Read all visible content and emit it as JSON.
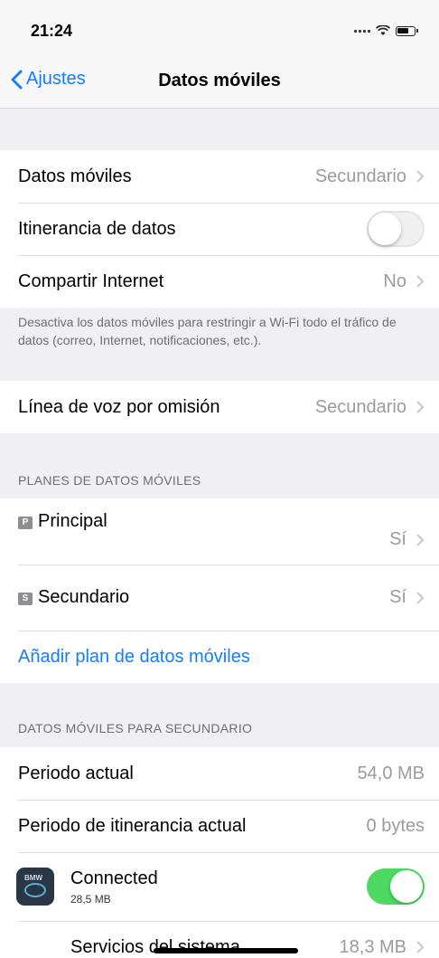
{
  "status": {
    "time": "21:24"
  },
  "nav": {
    "back_label": "Ajustes",
    "title": "Datos móviles"
  },
  "group1": {
    "datos_moviles": {
      "label": "Datos móviles",
      "value": "Secundario"
    },
    "itinerancia": {
      "label": "Itinerancia de datos",
      "enabled": false
    },
    "compartir": {
      "label": "Compartir Internet",
      "value": "No"
    }
  },
  "footnote": "Desactiva los datos móviles para restringir a Wi-Fi todo el tráfico de datos (correo, Internet, notificaciones, etc.).",
  "voice": {
    "label": "Línea de voz por omisión",
    "value": "Secundario"
  },
  "plans": {
    "header": "PLANES DE DATOS MÓVILES",
    "items": [
      {
        "badge": "P",
        "label": "Principal",
        "value": "Sí"
      },
      {
        "badge": "S",
        "label": "Secundario",
        "value": "Sí"
      }
    ],
    "add_label": "Añadir plan de datos móviles"
  },
  "usage": {
    "header": "DATOS MÓVILES PARA SECUNDARIO",
    "current": {
      "label": "Periodo actual",
      "value": "54,0 MB"
    },
    "roaming": {
      "label": "Periodo de itinerancia actual",
      "value": "0 bytes"
    },
    "app": {
      "name": "Connected",
      "size": "28,5 MB",
      "enabled": true,
      "icon_text": "BMW"
    },
    "system": {
      "label": "Servicios del sistema",
      "value": "18,3 MB"
    }
  },
  "colors": {
    "accent": "#147efb",
    "toggle_on": "#4cd964"
  }
}
